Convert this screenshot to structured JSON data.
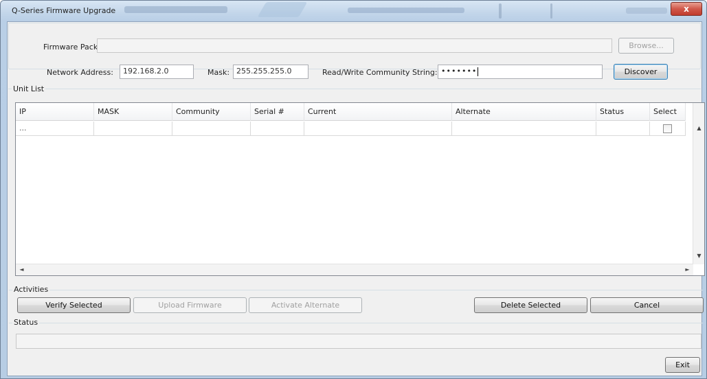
{
  "window": {
    "title": "Q-Series Firmware Upgrade",
    "close_glyph": "x"
  },
  "firmware": {
    "label": "Firmware Pack:",
    "value": "",
    "browse_label": "Browse..."
  },
  "network": {
    "address_label": "Network Address:",
    "address_value": "192.168.2.0",
    "mask_label": "Mask:",
    "mask_value": "255.255.255.0",
    "community_label": "Read/Write Community String:",
    "community_value": "•••••••",
    "discover_label": "Discover"
  },
  "unit_list": {
    "title": "Unit List",
    "columns": [
      "IP",
      "MASK",
      "Community",
      "Serial #",
      "Current",
      "Alternate",
      "Status",
      "Select"
    ],
    "rows": [
      {
        "ip": "...",
        "mask": "",
        "community": "",
        "serial": "",
        "current": "",
        "alternate": "",
        "status": "",
        "select": false
      }
    ],
    "scroll_up": "▲",
    "scroll_down": "▼",
    "scroll_left": "◄",
    "scroll_right": "►"
  },
  "activities": {
    "title": "Activities",
    "verify_label": "Verify Selected",
    "upload_label": "Upload Firmware",
    "activate_label": "Activate Alternate",
    "delete_label": "Delete Selected",
    "cancel_label": "Cancel"
  },
  "status": {
    "title": "Status",
    "value": ""
  },
  "footer": {
    "exit_label": "Exit"
  },
  "colors": {
    "window_frame": "#b9cfe6",
    "close_button": "#c13c2e",
    "client_bg": "#f0f0f0"
  }
}
